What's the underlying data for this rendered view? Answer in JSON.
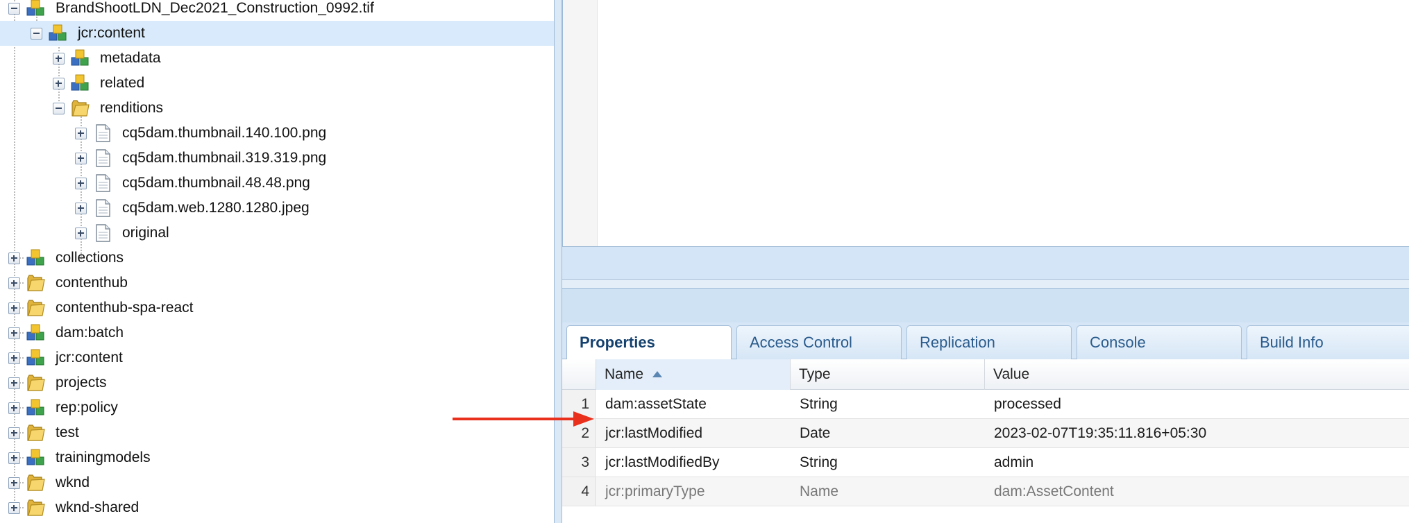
{
  "tree": {
    "nodes": [
      {
        "label": "BrandShootLDN_Dec2021_Construction_0992.tif",
        "icon": "node-icon",
        "toggle": "minus"
      },
      {
        "label": "jcr:content",
        "icon": "node-icon",
        "toggle": "minus",
        "selected": true
      },
      {
        "label": "metadata",
        "icon": "node-icon",
        "toggle": "plus"
      },
      {
        "label": "related",
        "icon": "node-icon",
        "toggle": "plus"
      },
      {
        "label": "renditions",
        "icon": "folder-icon",
        "toggle": "minus"
      },
      {
        "label": "cq5dam.thumbnail.140.100.png",
        "icon": "file-icon",
        "toggle": "plus"
      },
      {
        "label": "cq5dam.thumbnail.319.319.png",
        "icon": "file-icon",
        "toggle": "plus"
      },
      {
        "label": "cq5dam.thumbnail.48.48.png",
        "icon": "file-icon",
        "toggle": "plus"
      },
      {
        "label": "cq5dam.web.1280.1280.jpeg",
        "icon": "file-icon",
        "toggle": "plus"
      },
      {
        "label": "original",
        "icon": "file-icon",
        "toggle": "plus"
      },
      {
        "label": "collections",
        "icon": "node-icon",
        "toggle": "plus"
      },
      {
        "label": "contenthub",
        "icon": "folder-icon",
        "toggle": "plus"
      },
      {
        "label": "contenthub-spa-react",
        "icon": "folder-icon",
        "toggle": "plus"
      },
      {
        "label": "dam:batch",
        "icon": "node-icon",
        "toggle": "plus"
      },
      {
        "label": "jcr:content",
        "icon": "node-icon",
        "toggle": "plus"
      },
      {
        "label": "projects",
        "icon": "folder-icon",
        "toggle": "plus"
      },
      {
        "label": "rep:policy",
        "icon": "node-icon",
        "toggle": "plus"
      },
      {
        "label": "test",
        "icon": "folder-icon",
        "toggle": "plus"
      },
      {
        "label": "trainingmodels",
        "icon": "node-icon",
        "toggle": "plus"
      },
      {
        "label": "wknd",
        "icon": "folder-icon",
        "toggle": "plus"
      },
      {
        "label": "wknd-shared",
        "icon": "folder-icon",
        "toggle": "plus"
      }
    ]
  },
  "tabs": [
    {
      "label": "Properties",
      "active": true
    },
    {
      "label": "Access Control"
    },
    {
      "label": "Replication"
    },
    {
      "label": "Console"
    },
    {
      "label": "Build Info"
    }
  ],
  "grid": {
    "columns": [
      "Name",
      "Type",
      "Value"
    ],
    "sorted_column": "Name",
    "sort_direction": "ascending",
    "rows": [
      {
        "num": "1",
        "name": "dam:assetState",
        "type": "String",
        "value": "processed"
      },
      {
        "num": "2",
        "name": "jcr:lastModified",
        "type": "Date",
        "value": "2023-02-07T19:35:11.816+05:30"
      },
      {
        "num": "3",
        "name": "jcr:lastModifiedBy",
        "type": "String",
        "value": "admin"
      },
      {
        "num": "4",
        "name": "jcr:primaryType",
        "type": "Name",
        "value": "dam:AssetContent",
        "muted": true
      }
    ]
  },
  "annotation": {
    "arrow_color": "#e8301c"
  }
}
